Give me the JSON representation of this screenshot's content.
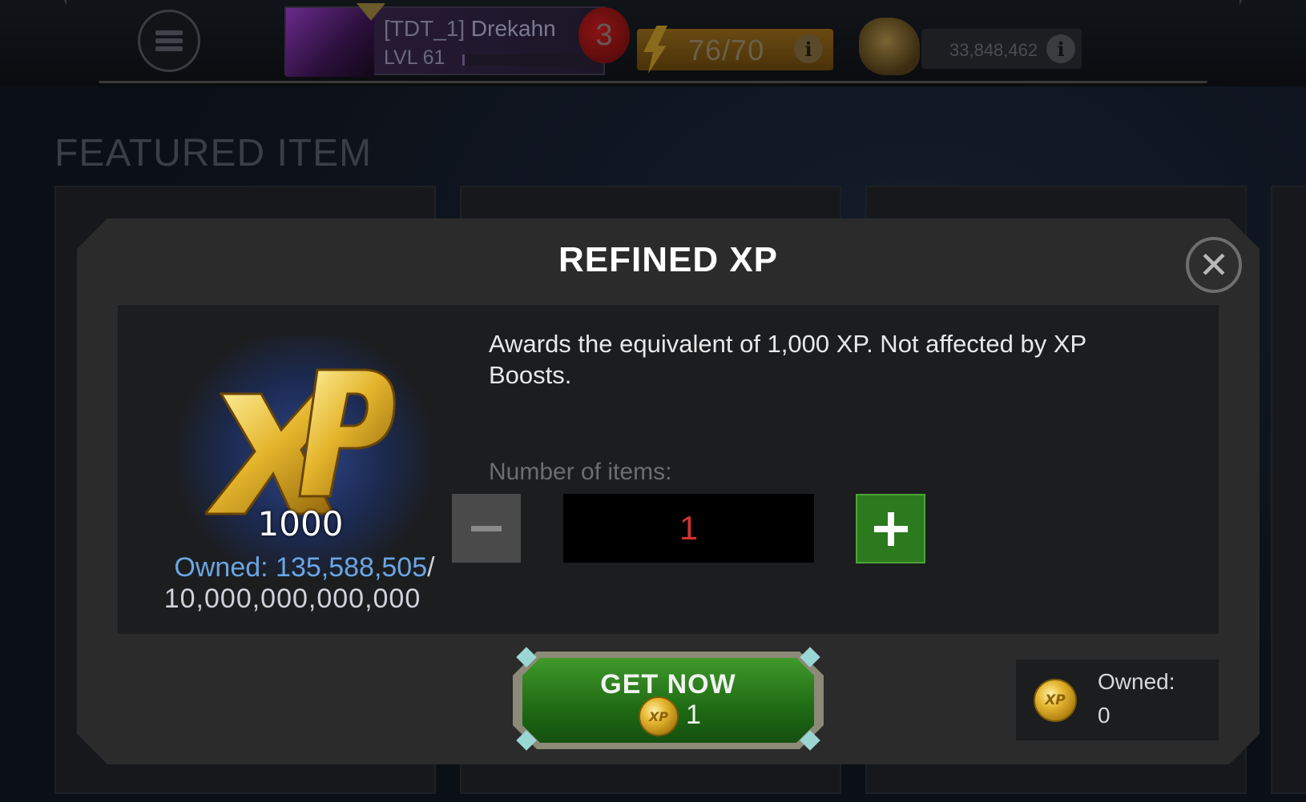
{
  "hud": {
    "player_tag": "[TDT_1]",
    "player_name": "Drekahn",
    "player_level": "LVL 61",
    "rank_badge": "3",
    "energy": "76/70",
    "gold": "33,848,462",
    "info_glyph": "i"
  },
  "background": {
    "section_title": "FEATURED ITEM"
  },
  "modal": {
    "title": "REFINED XP",
    "close_glyph": "✕",
    "item_amount": "1000",
    "owned_label": "Owned:",
    "owned_value": "135,588,505",
    "owned_separator": "/",
    "owned_max": "10,000,000,000,000",
    "description": "Awards the equivalent of 1,000 XP. Not affected by XP Boosts.",
    "quantity_label": "Number of items:",
    "quantity_value": "1",
    "buy_label": "GET NOW",
    "cost_value": "1",
    "coin_owned_label": "Owned:",
    "coin_owned_value": "0"
  },
  "icons": {
    "menu": "menu-icon",
    "close": "close-icon",
    "energy": "energy-bolt-icon",
    "gold": "gold-icon",
    "info": "info-icon",
    "currency": "xp-coin-icon",
    "minus": "minus-icon",
    "plus": "plus-icon"
  },
  "colors": {
    "buy_button": "#2f8a1e",
    "plus_button": "#2c7a1e",
    "quantity_text": "#d0342c",
    "owned_highlight": "#6aa6e4",
    "modal_bg": "#2b2b2b"
  }
}
